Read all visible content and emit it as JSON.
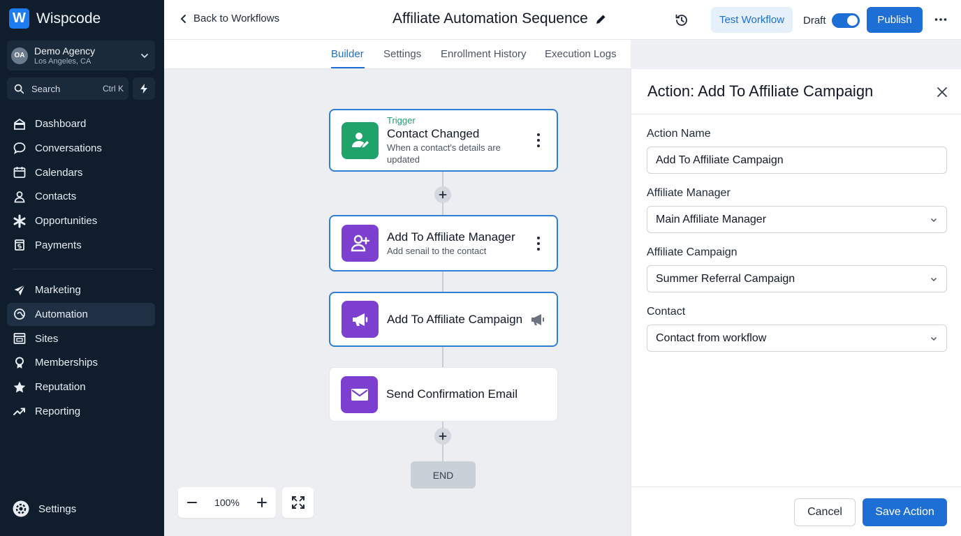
{
  "app": {
    "logo_letter": "W",
    "name": "Wispcode"
  },
  "account": {
    "initials": "OA",
    "name": "Demo Agency",
    "location": "Los Angeles, CA"
  },
  "search": {
    "label": "Search",
    "shortcut": "Ctrl K"
  },
  "nav": {
    "items": [
      {
        "label": "Dashboard",
        "icon": "home-icon"
      },
      {
        "label": "Conversations",
        "icon": "chat-icon"
      },
      {
        "label": "Calendars",
        "icon": "calendar-icon"
      },
      {
        "label": "Contacts",
        "icon": "person-icon"
      },
      {
        "label": "Opportunities",
        "icon": "asterisk-icon"
      },
      {
        "label": "Payments",
        "icon": "receipt-icon"
      }
    ],
    "items2": [
      {
        "label": "Marketing",
        "icon": "send-icon"
      },
      {
        "label": "Automation",
        "icon": "automation-icon",
        "active": true
      },
      {
        "label": "Sites",
        "icon": "browser-icon"
      },
      {
        "label": "Memberships",
        "icon": "badge-icon"
      },
      {
        "label": "Reputation",
        "icon": "star-icon"
      },
      {
        "label": "Reporting",
        "icon": "trend-icon"
      }
    ],
    "settings": "Settings"
  },
  "header": {
    "back": "Back to Workflows",
    "title": "Affiliate Automation Sequence",
    "test": "Test Workflow",
    "draft": "Draft",
    "draft_on": true,
    "publish": "Publish"
  },
  "tabs": [
    "Builder",
    "Settings",
    "Enrollment History",
    "Execution Logs"
  ],
  "active_tab": "Builder",
  "workflow": {
    "trigger": {
      "kind": "Trigger",
      "title": "Contact Changed",
      "sub": "When a contact's details are updated"
    },
    "step1": {
      "title": "Add To Affiliate Manager",
      "sub": "Add senail to the contact"
    },
    "step2": {
      "title": "Add To Affiliate Campaign"
    },
    "step3": {
      "title": "Send Confirmation Email"
    },
    "end": "END"
  },
  "zoom": {
    "value": "100%"
  },
  "panel": {
    "title": "Action: Add To Affiliate Campaign",
    "fields": [
      {
        "label": "Action Name",
        "value": "Add To Affiliate Campaign"
      },
      {
        "label": "Affiliate Manager",
        "value": "Main Affiliate Manager"
      },
      {
        "label": "Affiliate Campaign",
        "value": "Summer Referral Campaign"
      },
      {
        "label": "Contact",
        "value": "Contact from workflow"
      }
    ],
    "cancel": "Cancel",
    "save": "Save Action"
  },
  "colors": {
    "primary": "#1d6fd6",
    "sidebar": "#0f1d2c",
    "trigger_green": "#1fa36b",
    "action_purple": "#7c3fd0"
  }
}
